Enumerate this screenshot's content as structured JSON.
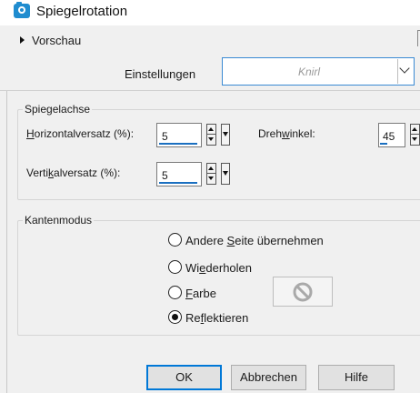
{
  "window": {
    "title": "Spiegelrotation",
    "icon": "camera-icon"
  },
  "preview": {
    "label": "Vorschau",
    "expanded": false
  },
  "settings": {
    "label": "Einstellungen",
    "value": "Knirl"
  },
  "mirror_axis": {
    "legend": "Spiegelachse",
    "horizontal": {
      "label_pre": "",
      "label_u": "H",
      "label_post": "orizontalversatz (%):",
      "value": "5"
    },
    "vertical": {
      "label_pre": "Verti",
      "label_u": "k",
      "label_post": "alversatz (%):",
      "value": "5"
    },
    "rotation": {
      "label_pre": "Dreh",
      "label_u": "w",
      "label_post": "inkel:",
      "value": "45"
    }
  },
  "edge_mode": {
    "legend": "Kantenmodus",
    "options": [
      {
        "pre": "Andere ",
        "u": "S",
        "post": "eite übernehmen",
        "checked": false
      },
      {
        "pre": "Wi",
        "u": "e",
        "post": "derholen",
        "checked": false
      },
      {
        "pre": "",
        "u": "F",
        "post": "arbe",
        "checked": false
      },
      {
        "pre": "Re",
        "u": "f",
        "post": "lektieren",
        "checked": true
      }
    ],
    "color_well_icon": "no-symbol-icon"
  },
  "buttons": {
    "ok": "OK",
    "cancel": "Abbrechen",
    "help": "Hilfe"
  },
  "colors": {
    "accent": "#0078d7",
    "title_icon": "#1f8ccf",
    "background": "#f0f0f0"
  }
}
